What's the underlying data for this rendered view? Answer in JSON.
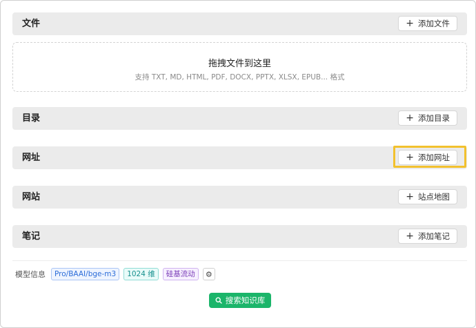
{
  "sections": {
    "files": {
      "title": "文件",
      "button": "添加文件"
    },
    "directory": {
      "title": "目录",
      "button": "添加目录"
    },
    "url": {
      "title": "网址",
      "button": "添加网址"
    },
    "website": {
      "title": "网站",
      "button": "站点地图"
    },
    "notes": {
      "title": "笔记",
      "button": "添加笔记"
    }
  },
  "dropzone": {
    "title": "拖拽文件到这里",
    "subtitle": "支持 TXT, MD, HTML, PDF, DOCX, PPTX, XLSX, EPUB... 格式"
  },
  "model_info": {
    "label": "模型信息",
    "model": "Pro/BAAI/bge-m3",
    "dimensions": "1024 维",
    "provider": "硅基流动"
  },
  "search_button": "搜索知识库",
  "colors": {
    "highlight": "#f2c12e",
    "primary": "#1bb56a"
  }
}
